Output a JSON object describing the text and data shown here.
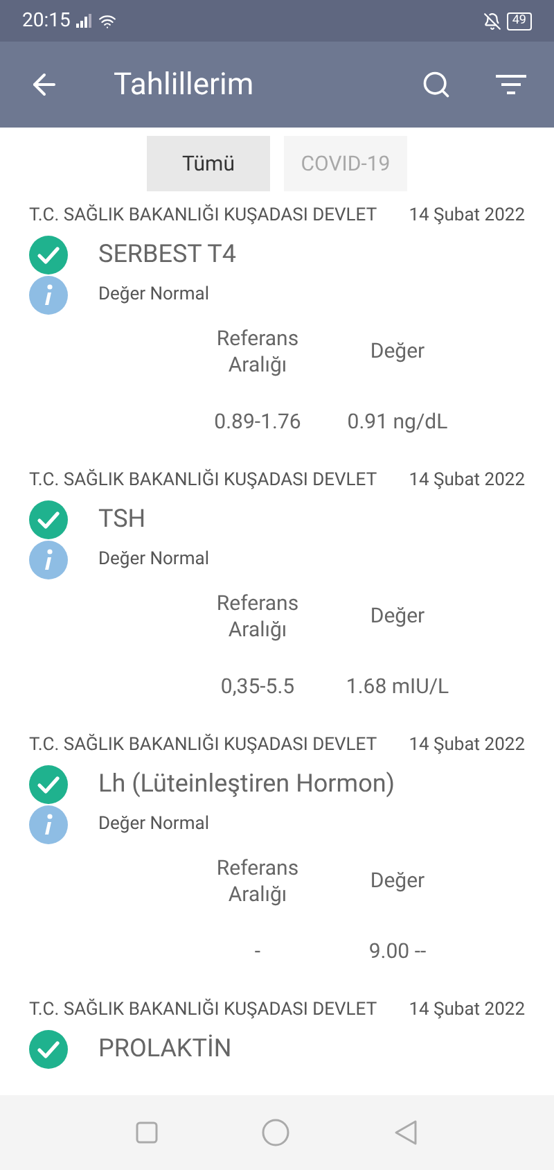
{
  "status_bar": {
    "time": "20:15",
    "battery": "49"
  },
  "app_bar": {
    "title": "Tahlillerim"
  },
  "tabs": [
    {
      "label": "Tümü",
      "selected": true
    },
    {
      "label": "COVID-19",
      "selected": false
    }
  ],
  "results": [
    {
      "hospital": "T.C. SAĞLIK BAKANLIĞI KUŞADASI DEVLET",
      "date": "14 Şubat 2022",
      "name": "SERBEST T4",
      "normal": true,
      "note": "Değer Normal",
      "range_label": "Referans Aralığı",
      "value_label": "Değer",
      "range": "0.89-1.76",
      "value": "0.91 ng/dL"
    },
    {
      "hospital": "T.C. SAĞLIK BAKANLIĞI KUŞADASI DEVLET",
      "date": "14 Şubat 2022",
      "name": "TSH",
      "normal": true,
      "note": "Değer Normal",
      "range_label": "Referans Aralığı",
      "value_label": "Değer",
      "range": "0,35-5.5",
      "value": "1.68 mIU/L"
    },
    {
      "hospital": "T.C. SAĞLIK BAKANLIĞI KUŞADASI DEVLET",
      "date": "14 Şubat 2022",
      "name": "Lh (Lüteinleştiren Hormon)",
      "normal": true,
      "note": "Değer Normal",
      "range_label": "Referans Aralığı",
      "value_label": "Değer",
      "range": "-",
      "value": "9.00 --"
    },
    {
      "hospital": "T.C. SAĞLIK BAKANLIĞI KUŞADASI DEVLET",
      "date": "14 Şubat 2022",
      "name": "PROLAKTİN",
      "normal": true
    }
  ]
}
